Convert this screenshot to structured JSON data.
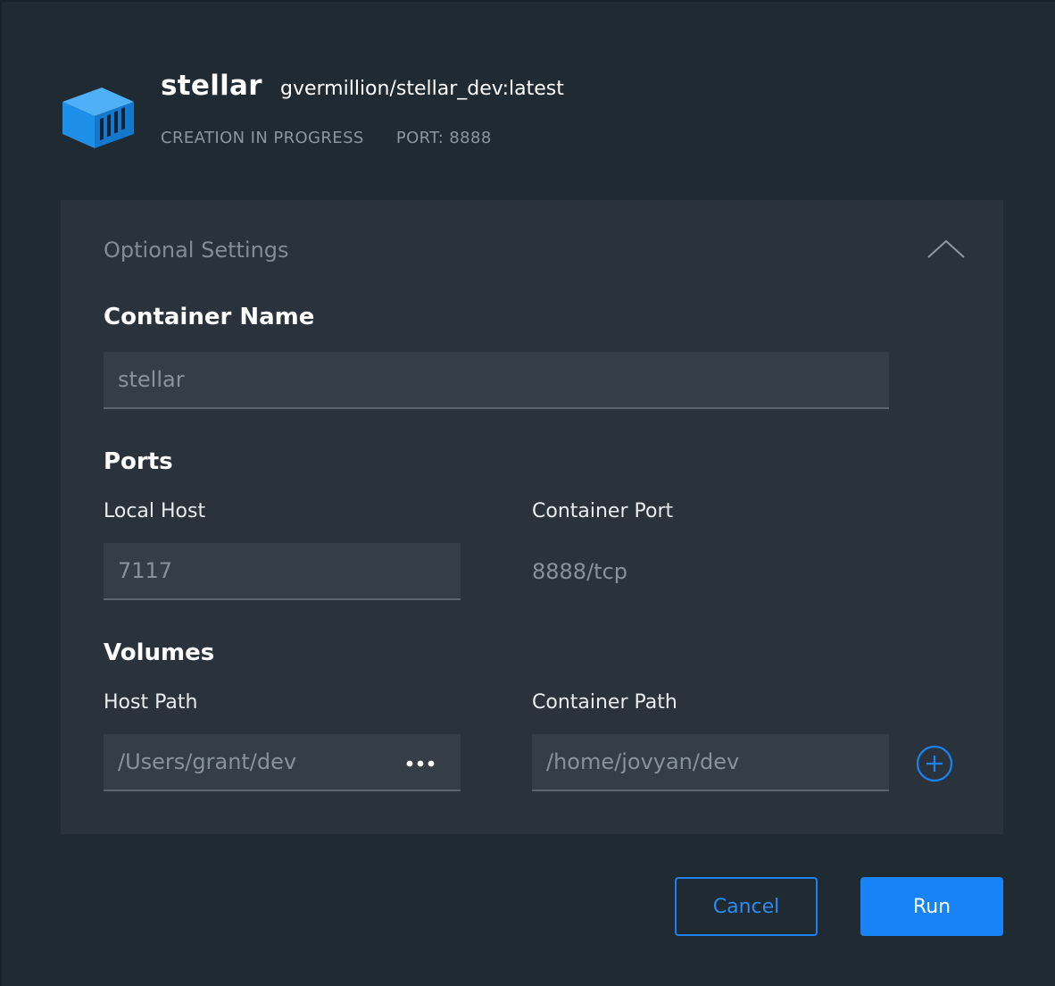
{
  "header": {
    "logo_icon": "container-box-icon",
    "name": "stellar",
    "image": "gvermillion/stellar_dev:latest",
    "status": "CREATION IN PROGRESS",
    "port": "PORT: 8888"
  },
  "settings": {
    "title": "Optional Settings",
    "collapse_icon": "chevron-up-icon",
    "container_name": {
      "label": "Container Name",
      "placeholder": "stellar"
    },
    "ports": {
      "label": "Ports",
      "local_host_label": "Local Host",
      "local_host_placeholder": "7117",
      "container_port_label": "Container Port",
      "container_port_value": "8888/tcp"
    },
    "volumes": {
      "label": "Volumes",
      "host_path_label": "Host Path",
      "host_path_placeholder": "/Users/grant/dev",
      "container_path_label": "Container Path",
      "container_path_placeholder": "/home/jovyan/dev",
      "browse_icon": "more-horizontal-icon",
      "add_icon": "plus-circle-icon"
    }
  },
  "actions": {
    "cancel_label": "Cancel",
    "run_label": "Run"
  },
  "colors": {
    "background": "#1f2a33",
    "panel": "#2a333c",
    "input": "#353e47",
    "accent": "#1883f7",
    "logo": "#2196f3"
  }
}
